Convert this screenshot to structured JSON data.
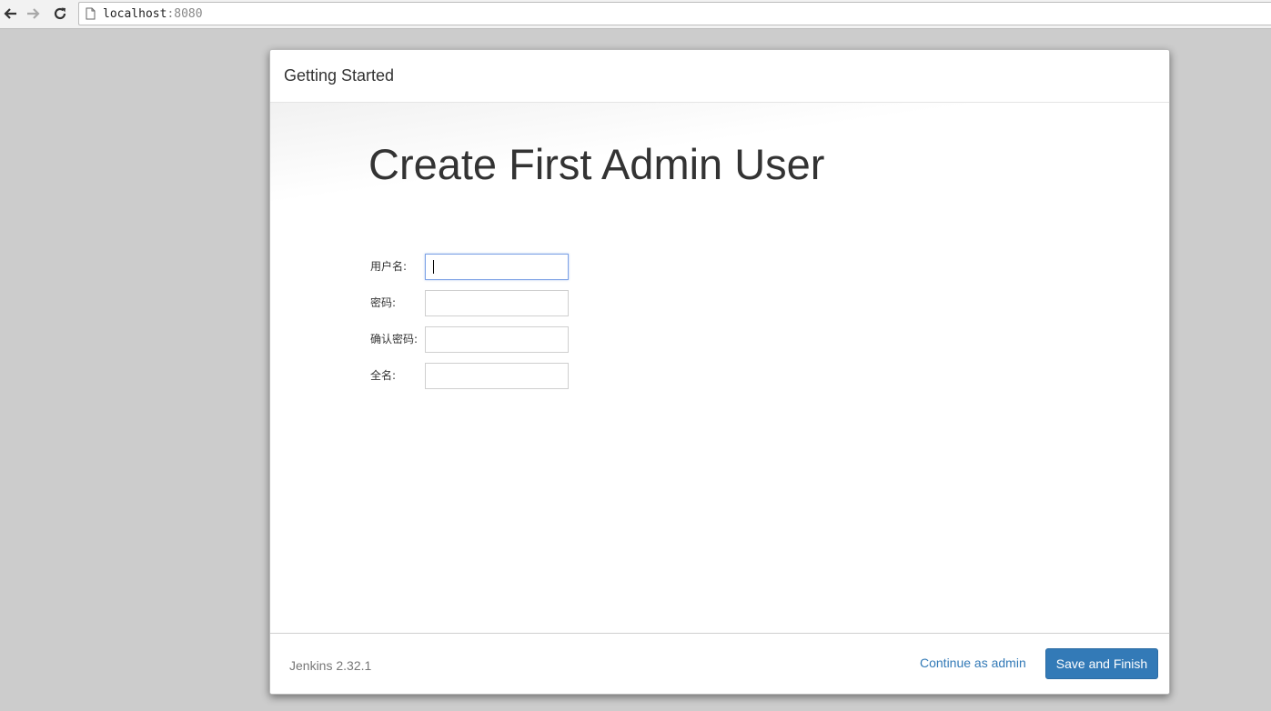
{
  "browser": {
    "url_host": "localhost",
    "url_port": ":8080"
  },
  "dialog": {
    "title": "Getting Started",
    "heading": "Create First Admin User",
    "form": {
      "fields": [
        {
          "label": "用户名:",
          "value": ""
        },
        {
          "label": "密码:",
          "value": ""
        },
        {
          "label": "确认密码:",
          "value": ""
        },
        {
          "label": "全名:",
          "value": ""
        }
      ]
    },
    "footer": {
      "version": "Jenkins 2.32.1",
      "continue_label": "Continue as admin",
      "save_label": "Save and Finish"
    }
  },
  "colors": {
    "primary": "#337ab7",
    "backdrop": "#cccccc"
  }
}
